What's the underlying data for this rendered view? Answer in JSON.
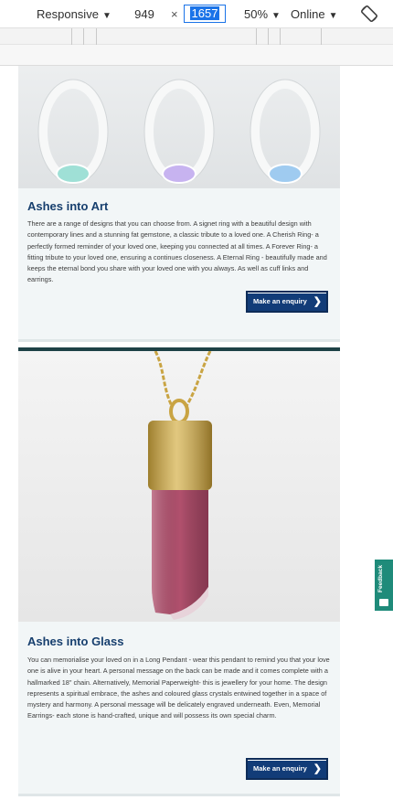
{
  "devtools": {
    "device": "Responsive",
    "width": "949",
    "times": "×",
    "height": "1657",
    "zoom": "50%",
    "network": "Online",
    "rotate_icon": "rotate-icon"
  },
  "cards": [
    {
      "title": "Ashes into Art",
      "description": "There are a range of designs that you can choose from. A signet ring with a beautiful design with contemporary lines and a stunning fat gemstone, a classic tribute to a loved one. A Cherish Ring- a perfectly formed reminder of your loved one, keeping you connected at all times. A Forever Ring- a fitting tribute to your loved one, ensuring a continues closeness. A Eternal Ring - beautifully made and keeps the eternal bond you share with your loved one with you always. As well as cuff links and earrings.",
      "button": "Make an enquiry",
      "ring_gem_colors": [
        "#9fe0d6",
        "#c7b3f0",
        "#9fcbf0"
      ],
      "ring_metal_colors": [
        "#b9c4bc",
        "#d8c08a",
        "#d5a796"
      ]
    },
    {
      "title": "Ashes into Glass",
      "description": "You can memorialise your loved on in a Long Pendant - wear this pendant to remind you that your love one is alive in your heart. A personal message on the back can be made and it comes complete with a hallmarked 18\" chain. Alternatively, Memorial Paperweight- this is jewellery for your home. The design represents a spiritual embrace, the ashes and coloured glass crystals entwined together in a space of mystery and harmony. A personal message will be delicately engraved underneath. Even, Memorial Earrings- each stone is hand-crafted, unique and will possess its own special charm.",
      "button": "Make an enquiry",
      "pendant_glass_color": "#b0506d",
      "pendant_metal_color": "#c9a443"
    }
  ],
  "feedback": {
    "label": "Feedback"
  },
  "colors": {
    "title": "#173f6e",
    "button": "#123c78",
    "card_divider": "#1d4146",
    "feedback": "#1f8b7a"
  }
}
